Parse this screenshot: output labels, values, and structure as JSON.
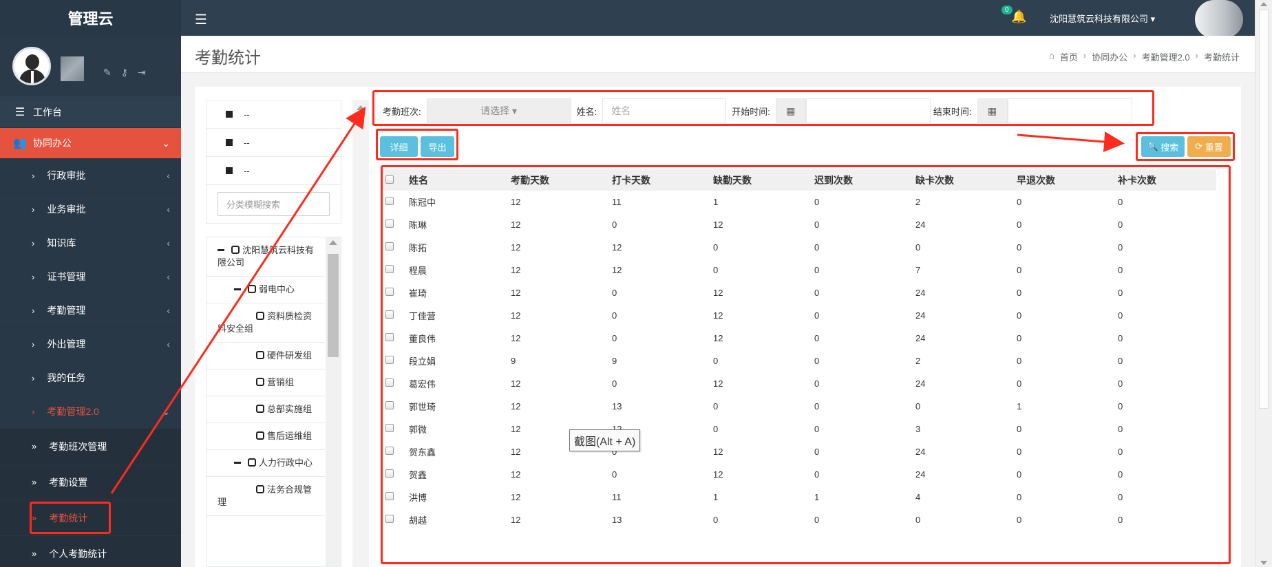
{
  "sidebar": {
    "brand": "管理云",
    "items": [
      {
        "label": "工作台",
        "icon": "indent-icon"
      },
      {
        "label": "协同办公",
        "icon": "users-icon"
      },
      {
        "label": "行政审批"
      },
      {
        "label": "业务审批"
      },
      {
        "label": "知识库"
      },
      {
        "label": "证书管理"
      },
      {
        "label": "考勤管理"
      },
      {
        "label": "外出管理"
      },
      {
        "label": "我的任务"
      },
      {
        "label": "考勤管理2.0"
      },
      {
        "label": "考勤班次管理"
      },
      {
        "label": "考勤设置"
      },
      {
        "label": "考勤统计"
      },
      {
        "label": "个人考勤统计"
      }
    ]
  },
  "header": {
    "notification_count": "0",
    "company": "沈阳慧筑云科技有限公司"
  },
  "page": {
    "title": "考勤统计",
    "breadcrumb": [
      "首页",
      "协同办公",
      "考勤管理2.0",
      "考勤统计"
    ]
  },
  "tree_panel": {
    "legend": [
      "--",
      "--",
      "--"
    ],
    "search_placeholder": "分类模糊搜索",
    "nodes": [
      "沈阳慧筑云科技有限公司",
      "弱电中心",
      "资料质检资料安全组",
      "硬件研发组",
      "营销组",
      "总部实施组",
      "售后运维组",
      "人力行政中心",
      "法务合规管理"
    ]
  },
  "filters": {
    "shift_label": "考勤班次:",
    "shift_value": "请选择",
    "name_label": "姓名:",
    "name_placeholder": "姓名",
    "start_label": "开始时间:",
    "end_label": "结束时间:"
  },
  "buttons": {
    "detail": "详细",
    "export": "导出",
    "search": "搜索",
    "reset": "重置"
  },
  "table": {
    "headers": [
      "姓名",
      "考勤天数",
      "打卡天数",
      "缺勤天数",
      "迟到次数",
      "缺卡次数",
      "早退次数",
      "补卡次数"
    ],
    "rows": [
      [
        "陈冠中",
        "12",
        "11",
        "1",
        "0",
        "2",
        "0",
        "0"
      ],
      [
        "陈琳",
        "12",
        "0",
        "12",
        "0",
        "24",
        "0",
        "0"
      ],
      [
        "陈拓",
        "12",
        "12",
        "0",
        "0",
        "0",
        "0",
        "0"
      ],
      [
        "程晨",
        "12",
        "12",
        "0",
        "0",
        "7",
        "0",
        "0"
      ],
      [
        "崔琦",
        "12",
        "0",
        "12",
        "0",
        "24",
        "0",
        "0"
      ],
      [
        "丁佳营",
        "12",
        "0",
        "12",
        "0",
        "24",
        "0",
        "0"
      ],
      [
        "董良伟",
        "12",
        "0",
        "12",
        "0",
        "24",
        "0",
        "0"
      ],
      [
        "段立娟",
        "9",
        "9",
        "0",
        "0",
        "2",
        "0",
        "0"
      ],
      [
        "葛宏伟",
        "12",
        "0",
        "12",
        "0",
        "24",
        "0",
        "0"
      ],
      [
        "郭世琦",
        "12",
        "13",
        "0",
        "0",
        "0",
        "1",
        "0"
      ],
      [
        "郭微",
        "12",
        "12",
        "0",
        "0",
        "3",
        "0",
        "0"
      ],
      [
        "贺东鑫",
        "12",
        "0",
        "12",
        "0",
        "24",
        "0",
        "0"
      ],
      [
        "贺鑫",
        "12",
        "0",
        "12",
        "0",
        "24",
        "0",
        "0"
      ],
      [
        "洪博",
        "12",
        "11",
        "1",
        "1",
        "4",
        "0",
        "0"
      ],
      [
        "胡越",
        "12",
        "13",
        "0",
        "0",
        "0",
        "0",
        "0"
      ]
    ]
  },
  "tooltip": "截图(Alt + A)",
  "colors": {
    "sidebar_bg": "#2f4050",
    "active_menu": "#e5533f",
    "annotation_red": "#ff2b1c",
    "btn_info": "#5bc0de",
    "btn_warning": "#f0ad4e"
  }
}
